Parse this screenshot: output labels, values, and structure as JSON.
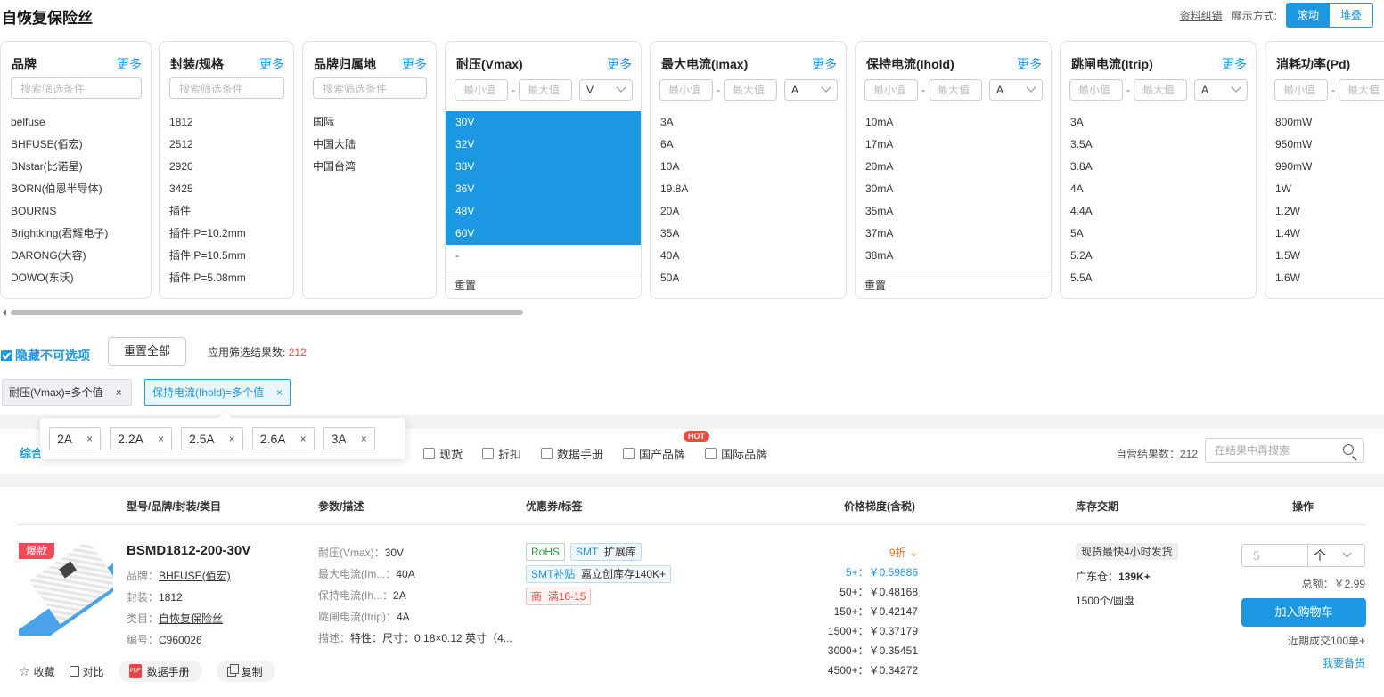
{
  "page": {
    "title": "自恢复保险丝"
  },
  "top": {
    "error_link": "资料纠错",
    "display_label": "展示方式:",
    "mode_scroll": "滚动",
    "mode_stack": "堆叠"
  },
  "common": {
    "search_placeholder": "搜索筛选条件",
    "min_placeholder": "最小值",
    "max_placeholder": "最大值",
    "dash": "-",
    "more": "更多",
    "reset": "重置"
  },
  "filters": {
    "brand": {
      "title": "品牌",
      "items": [
        "belfuse",
        "BHFUSE(佰宏)",
        "BNstar(比诺星)",
        "BORN(伯恩半导体)",
        "BOURNS",
        "Brightking(君耀电子)",
        "DARONG(大容)",
        "DOWO(东沃)"
      ]
    },
    "package": {
      "title": "封装/规格",
      "items": [
        "1812",
        "2512",
        "2920",
        "3425",
        "插件",
        "插件,P=10.2mm",
        "插件,P=10.5mm",
        "插件,P=5.08mm"
      ]
    },
    "region": {
      "title": "品牌归属地",
      "items": [
        "国际",
        "中国大陆",
        "中国台湾"
      ]
    },
    "vmax": {
      "title": "耐压(Vmax)",
      "unit": "V",
      "items": [
        "30V",
        "32V",
        "33V",
        "36V",
        "48V",
        "60V",
        "-"
      ],
      "selected": [
        "30V",
        "32V",
        "33V",
        "36V",
        "48V",
        "60V"
      ]
    },
    "imax": {
      "title": "最大电流(Imax)",
      "unit": "A",
      "items": [
        "3A",
        "6A",
        "10A",
        "19.8A",
        "20A",
        "35A",
        "40A",
        "50A"
      ]
    },
    "ihold": {
      "title": "保持电流(Ihold)",
      "unit": "A",
      "items": [
        "10mA",
        "17mA",
        "20mA",
        "30mA",
        "35mA",
        "37mA",
        "38mA"
      ]
    },
    "itrip": {
      "title": "跳闸电流(Itrip)",
      "unit": "A",
      "items": [
        "3A",
        "3.5A",
        "3.8A",
        "4A",
        "4.4A",
        "5A",
        "5.2A",
        "5.5A"
      ]
    },
    "pd": {
      "title": "消耗功率(Pd)",
      "items": [
        "800mW",
        "950mW",
        "990mW",
        "1W",
        "1.2W",
        "1.4W",
        "1.5W",
        "1.6W"
      ]
    }
  },
  "controls": {
    "hide_unavailable": "隐藏不可选项",
    "reset_all": "重置全部",
    "result_label": "应用筛选结果数:",
    "result_count": "212"
  },
  "chips": [
    {
      "label": "耐压(Vmax)=多个值",
      "close": "×"
    },
    {
      "label": "保持电流(Ihold)=多个值",
      "close": "×"
    }
  ],
  "popup_tags": [
    {
      "label": "2A",
      "close": "×"
    },
    {
      "label": "2.2A",
      "close": "×"
    },
    {
      "label": "2.5A",
      "close": "×"
    },
    {
      "label": "2.6A",
      "close": "×"
    },
    {
      "label": "3A",
      "close": "×"
    }
  ],
  "sortbar": {
    "sort_label": "综合",
    "options": [
      "现货",
      "折扣",
      "数据手册",
      "国产品牌",
      "国际品牌"
    ],
    "hot_badge": "HOT",
    "self_count": "自营结果数：212",
    "search_placeholder": "在结果中再搜索"
  },
  "table": {
    "headers": [
      "型号/品牌/封装/类目",
      "参数/描述",
      "优惠券/标签",
      "价格梯度(含税)",
      "库存交期",
      "操作"
    ]
  },
  "product": {
    "badge": "爆款",
    "name": "BSMD1812-200-30V",
    "brand_label": "品牌：",
    "brand": "BHFUSE(佰宏)",
    "package_label": "封装：",
    "package": "1812",
    "category_label": "类目：",
    "category": "自恢复保险丝",
    "code_label": "编号：",
    "code": "C960026",
    "params": [
      {
        "k": "耐压(Vmax)：",
        "v": "30V"
      },
      {
        "k": "最大电流(Im...：",
        "v": "40A"
      },
      {
        "k": "保持电流(Ih...：",
        "v": "2A"
      },
      {
        "k": "跳闸电流(Itrip)：",
        "v": "4A"
      },
      {
        "k": "描述：",
        "v": "特性：尺寸：0.18×0.12 英寸（4..."
      }
    ],
    "tags": {
      "rohs": "RoHS",
      "smt": "SMT",
      "ext_lib": "扩展库",
      "smt_fill": "SMT补贴",
      "jlc_stock": "嘉立创库存140K+",
      "shop": "商",
      "coupon": "满16-15"
    },
    "discount": "9折",
    "prices": [
      "5+：￥0.59886",
      "50+：￥0.48168",
      "150+：￥0.42147",
      "1500+：￥0.37179",
      "3000+：￥0.35451",
      "4500+：￥0.34272"
    ],
    "stock_ship": "现货最快4小时发货",
    "warehouse_label": "广东仓：",
    "warehouse": "139K+",
    "reel": "1500个/圆盘",
    "qty_placeholder": "5",
    "qty_up": "个",
    "total": "总额：￥2.99",
    "add_cart": "加入购物车",
    "recent_deals": "近期成交100单+",
    "spare": "我要备货",
    "actions": {
      "fav": "收藏",
      "compare": "对比",
      "datasheet": "数据手册",
      "copy": "复制",
      "pdf": "PDF"
    }
  }
}
